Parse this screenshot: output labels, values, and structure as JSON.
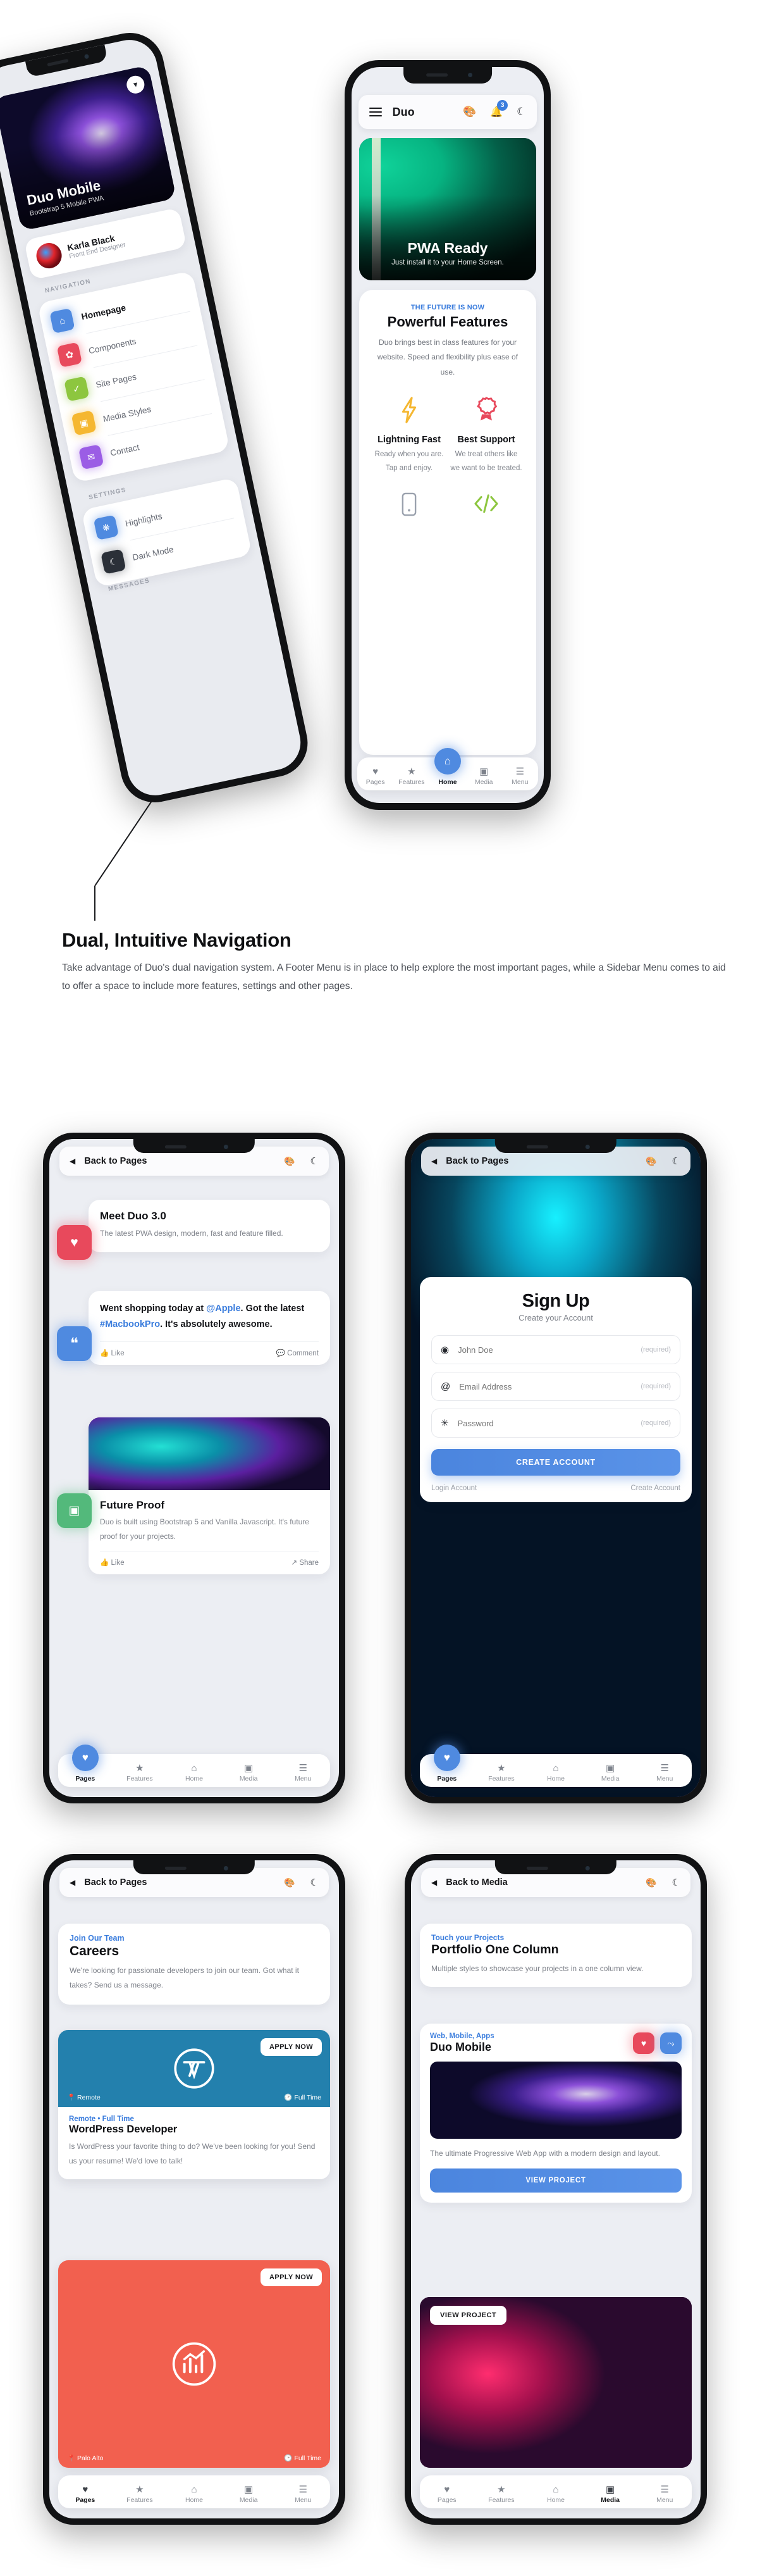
{
  "section": {
    "heading": "Dual, Intuitive Navigation",
    "body": "Take advantage of Duo's dual navigation system. A Footer Menu is in place to help explore the most important pages, while a Sidebar Menu comes to aid to offer a space to include more features, settings and  other pages."
  },
  "colors": {
    "accent": "#3b7ddd",
    "blue": "#4f8ae0",
    "red": "#e8495c",
    "green": "#53b97b",
    "yellow": "#f5b731",
    "wordpress": "#2380ad",
    "coral": "#f2604f"
  },
  "sidebar_phone": {
    "hero": {
      "title": "Duo Mobile",
      "subtitle": "Bootstrap 5 Mobile PWA",
      "close_icon": "close-icon"
    },
    "profile": {
      "name": "Karla Black",
      "role": "Front End Designer"
    },
    "group_navigation": "NAVIGATION",
    "nav_items": [
      {
        "label": "Homepage",
        "icon": "home-icon",
        "color": "#4f8ae0"
      },
      {
        "label": "Components",
        "icon": "gear-icon",
        "color": "#e8495c"
      },
      {
        "label": "Site Pages",
        "icon": "check-icon",
        "color": "#8dc63f"
      },
      {
        "label": "Media Styles",
        "icon": "image-icon",
        "color": "#f5b731"
      },
      {
        "label": "Contact",
        "icon": "chat-icon",
        "color": "#9b5de5"
      }
    ],
    "group_settings": "SETTINGS",
    "settings_items": [
      {
        "label": "Highlights",
        "icon": "palette-icon",
        "color": "#4f8ae0"
      },
      {
        "label": "Dark Mode",
        "icon": "moon-icon",
        "color": "#2b3038"
      }
    ],
    "group_messages": "MESSAGES"
  },
  "home_phone": {
    "appbar": {
      "menu_icon": "hamburger-icon",
      "title": "Duo",
      "palette_icon": "palette-icon",
      "bell_icon": "bell-icon",
      "bell_badge": "3",
      "moon_icon": "moon-icon"
    },
    "hero": {
      "title": "PWA Ready",
      "subtitle": "Just install it to your Home Screen."
    },
    "features": {
      "eyebrow": "THE FUTURE IS NOW",
      "title": "Powerful Features",
      "description": "Duo brings best in class features for your website. Speed and flexibility plus ease of use.",
      "items": [
        {
          "icon": "lightning-bolt-icon",
          "title": "Lightning Fast",
          "text": "Ready when you are. Tap and enjoy."
        },
        {
          "icon": "award-badge-icon",
          "title": "Best Support",
          "text": "We treat others like we want to be treated."
        },
        {
          "icon": "mobile-phone-icon",
          "title": "",
          "text": ""
        },
        {
          "icon": "code-brackets-icon",
          "title": "",
          "text": ""
        }
      ]
    },
    "tabs": [
      {
        "label": "Pages",
        "icon": "heart-icon",
        "active": false
      },
      {
        "label": "Features",
        "icon": "star-icon",
        "active": false
      },
      {
        "label": "Home",
        "icon": "home-icon",
        "active": true
      },
      {
        "label": "Media",
        "icon": "image-icon",
        "active": false
      },
      {
        "label": "Menu",
        "icon": "hamburger-icon",
        "active": false
      }
    ]
  },
  "pages_phone": {
    "appbar": {
      "back_icon": "back-arrow-icon",
      "title": "Back to Pages",
      "palette_icon": "palette-icon",
      "moon_icon": "moon-icon"
    },
    "card1": {
      "tile_icon": "heart-icon",
      "title": "Meet Duo 3.0",
      "text": "The latest PWA design, modern, fast and feature filled."
    },
    "card2": {
      "tile_icon": "quote-icon",
      "text_parts": [
        {
          "t": "Went shopping today at ",
          "style": "bold"
        },
        {
          "t": "@Apple",
          "style": "link"
        },
        {
          "t": ". Got the latest ",
          "style": "bold"
        },
        {
          "t": "#MacbookPro",
          "style": "link"
        },
        {
          "t": ". It's absolutely awesome.",
          "style": "bold"
        }
      ],
      "like_label": "Like",
      "like_icon": "thumbs-up-icon",
      "comment_label": "Comment",
      "comment_icon": "comment-bubble-icon"
    },
    "card3": {
      "tile_icon": "image-icon",
      "title": "Future Proof",
      "text": "Duo is built using Bootstrap 5 and Vanilla Javascript. It's future proof for your projects.",
      "like_label": "Like",
      "like_icon": "thumbs-up-icon",
      "share_label": "Share",
      "share_icon": "share-icon"
    },
    "tabs": [
      {
        "label": "Pages",
        "icon": "heart-icon",
        "active": true
      },
      {
        "label": "Features",
        "icon": "star-icon",
        "active": false
      },
      {
        "label": "Home",
        "icon": "home-icon",
        "active": false
      },
      {
        "label": "Media",
        "icon": "image-icon",
        "active": false
      },
      {
        "label": "Menu",
        "icon": "hamburger-icon",
        "active": false
      }
    ]
  },
  "signup_phone": {
    "appbar": {
      "back_icon": "back-arrow-icon",
      "title": "Back to Pages",
      "palette_icon": "palette-icon",
      "moon_icon": "moon-icon"
    },
    "title": "Sign Up",
    "subtitle": "Create your Account",
    "fields": [
      {
        "icon": "user-icon",
        "placeholder": "John Doe",
        "hint": "(required)"
      },
      {
        "icon": "at-icon",
        "placeholder": "Email Address",
        "hint": "(required)"
      },
      {
        "icon": "asterisk-icon",
        "placeholder": "Password",
        "hint": "(required)"
      }
    ],
    "submit_label": "CREATE ACCOUNT",
    "link_left": "Login Account",
    "link_right": "Create Account",
    "tabs": [
      {
        "label": "Pages",
        "icon": "heart-icon",
        "active": true
      },
      {
        "label": "Features",
        "icon": "star-icon",
        "active": false
      },
      {
        "label": "Home",
        "icon": "home-icon",
        "active": false
      },
      {
        "label": "Media",
        "icon": "image-icon",
        "active": false
      },
      {
        "label": "Menu",
        "icon": "hamburger-icon",
        "active": false
      }
    ]
  },
  "careers_phone": {
    "appbar": {
      "back_icon": "back-arrow-icon",
      "title": "Back to Pages",
      "palette_icon": "palette-icon",
      "moon_icon": "moon-icon"
    },
    "intro": {
      "eyebrow": "Join Our Team",
      "title": "Careers",
      "text": "We're looking for passionate developers to join our team. Got what it takes? Send us a message."
    },
    "job1": {
      "apply_label": "APPLY NOW",
      "logo": "wordpress-logo-icon",
      "location": "Remote",
      "location_icon": "pin-icon",
      "type": "Full Time",
      "type_icon": "clock-icon",
      "meta": "Remote • Full Time",
      "title": "WordPress Developer",
      "text": "Is WordPress your favorite thing to do? We've been looking for you! Send us your resume! We'd love to talk!"
    },
    "job2": {
      "apply_label": "APPLY NOW",
      "logo": "chart-growth-icon",
      "location": "Palo Alto",
      "location_icon": "pin-icon",
      "type": "Full Time",
      "type_icon": "clock-icon"
    },
    "tabs": [
      {
        "label": "Pages",
        "icon": "heart-icon",
        "active": true
      },
      {
        "label": "Features",
        "icon": "star-icon",
        "active": false
      },
      {
        "label": "Home",
        "icon": "home-icon",
        "active": false
      },
      {
        "label": "Media",
        "icon": "image-icon",
        "active": false
      },
      {
        "label": "Menu",
        "icon": "hamburger-icon",
        "active": false
      }
    ]
  },
  "portfolio_phone": {
    "appbar": {
      "back_icon": "back-arrow-icon",
      "title": "Back to Media",
      "palette_icon": "palette-icon",
      "moon_icon": "moon-icon"
    },
    "intro": {
      "eyebrow": "Touch your Projects",
      "title": "Portfolio One Column",
      "text": "Multiple styles to showcase your projects in a one column view."
    },
    "project1": {
      "eyebrow": "Web, Mobile, Apps",
      "title": "Duo Mobile",
      "like_icon": "heart-icon",
      "share_icon": "share-icon",
      "caption": "The ultimate Progressive Web App with a modern design and layout.",
      "button": "VIEW PROJECT"
    },
    "project2": {
      "button": "VIEW PROJECT"
    },
    "tabs": [
      {
        "label": "Pages",
        "icon": "heart-icon",
        "active": false
      },
      {
        "label": "Features",
        "icon": "star-icon",
        "active": false
      },
      {
        "label": "Home",
        "icon": "home-icon",
        "active": false
      },
      {
        "label": "Media",
        "icon": "image-icon",
        "active": true
      },
      {
        "label": "Menu",
        "icon": "hamburger-icon",
        "active": false
      }
    ]
  }
}
